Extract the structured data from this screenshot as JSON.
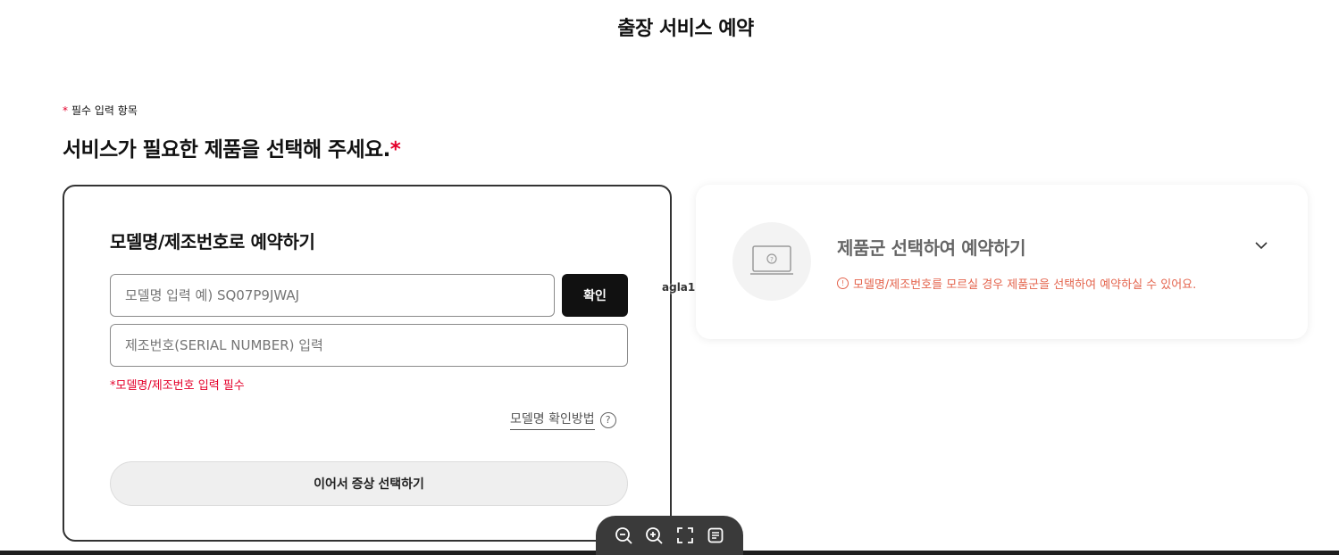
{
  "header": {
    "title": "출장 서비스 예약"
  },
  "form": {
    "required_marker": "*",
    "required_note": "필수 입력 항목",
    "section_title": "서비스가 필요한 제품을 선택해 주세요.",
    "section_title_marker": "*"
  },
  "model_card": {
    "title": "모델명/제조번호로 예약하기",
    "model_input_placeholder": "모델명 입력 예) SQ07P9JWAJ",
    "serial_input_placeholder": "제조번호(SERIAL NUMBER) 입력",
    "confirm_label": "확인",
    "error_text": "*모델명/제조번호 입력 필수",
    "howto_label": "모델명 확인방법",
    "howto_icon": "?",
    "next_label": "이어서 증상 선택하기"
  },
  "category_card": {
    "title": "제품군 선택하여 예약하기",
    "hint_icon": "!",
    "hint": "모델명/제조번호를 모르실 경우 제품군을 선택하여 예약하실 수 있어요.",
    "icon": "laptop-question-icon",
    "chevron": "chevron-down-icon"
  },
  "overlay": {
    "label": "agla1"
  },
  "viewer_toolbar": {
    "buttons": [
      "zoom-out-icon",
      "zoom-in-icon",
      "fullscreen-icon",
      "notes-icon"
    ]
  },
  "colors": {
    "accent_red": "#e4002b",
    "hint_orange": "#e4644d",
    "dark_button": "#111111",
    "toolbar_bg": "#3a3a3a"
  }
}
